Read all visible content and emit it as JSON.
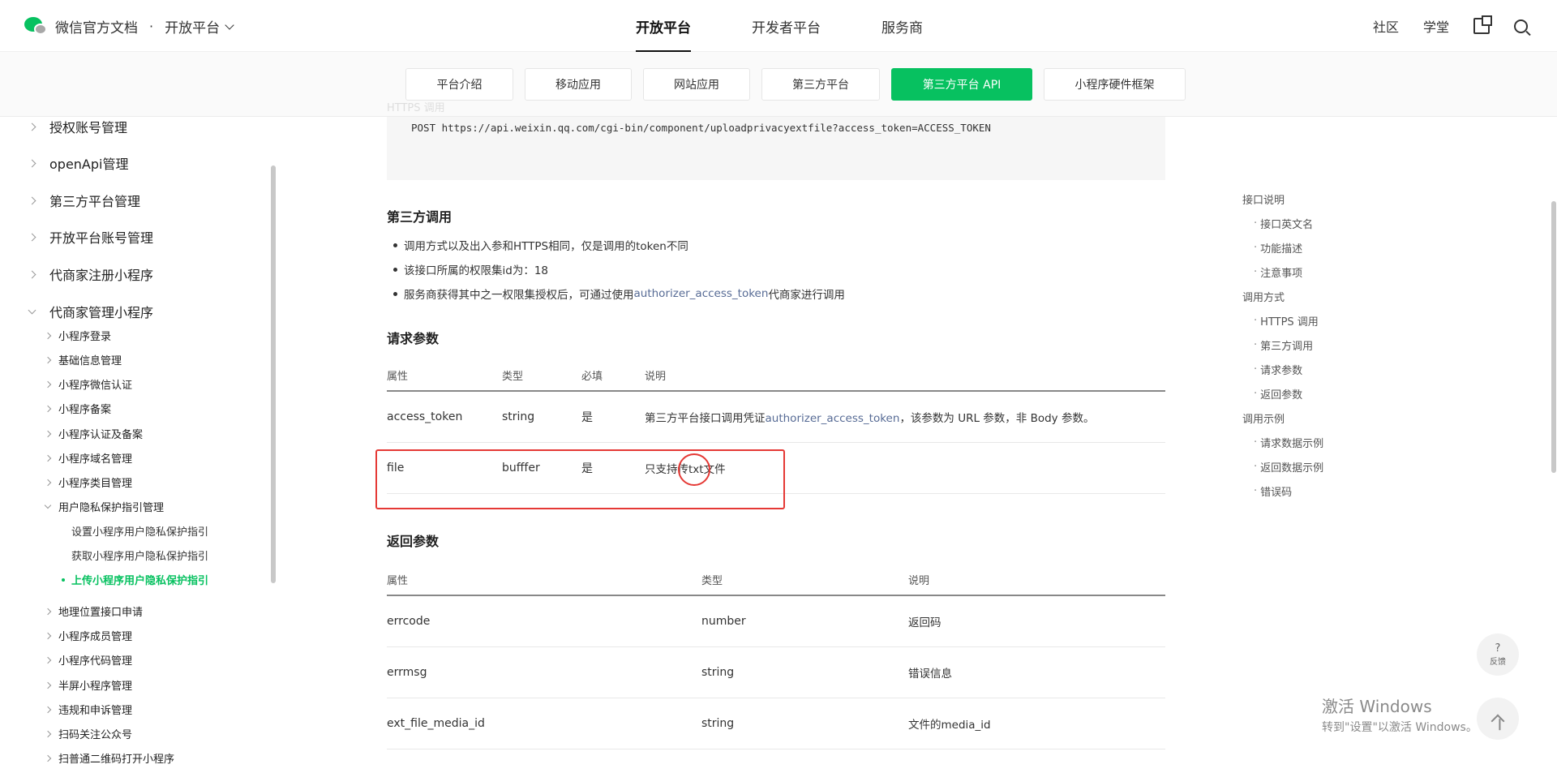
{
  "header": {
    "brand": "微信官方文档",
    "separator": "·",
    "platform_dropdown": "开放平台",
    "nav": [
      {
        "label": "开放平台",
        "active": true
      },
      {
        "label": "开发者平台",
        "active": false
      },
      {
        "label": "服务商",
        "active": false
      }
    ],
    "right": {
      "community": "社区",
      "academy": "学堂"
    }
  },
  "subnav": {
    "faint_heading": "HTTPS 调用",
    "tabs": [
      {
        "label": "平台介绍",
        "active": false
      },
      {
        "label": "移动应用",
        "active": false
      },
      {
        "label": "网站应用",
        "active": false
      },
      {
        "label": "第三方平台",
        "active": false
      },
      {
        "label": "第三方平台 API",
        "active": true
      },
      {
        "label": "小程序硬件框架",
        "active": false
      }
    ]
  },
  "sidebar": {
    "level1": [
      "授权账号管理",
      "openApi管理",
      "第三方平台管理",
      "开放平台账号管理",
      "代商家注册小程序",
      "代商家管理小程序"
    ],
    "level2_top": [
      "小程序登录",
      "基础信息管理",
      "小程序微信认证",
      "小程序备案",
      "小程序认证及备案",
      "小程序域名管理",
      "小程序类目管理",
      "用户隐私保护指引管理"
    ],
    "level3": [
      "设置小程序用户隐私保护指引",
      "获取小程序用户隐私保护指引",
      "上传小程序用户隐私保护指引"
    ],
    "level2_bottom": [
      "地理位置接口申请",
      "小程序成员管理",
      "小程序代码管理",
      "半屏小程序管理",
      "违规和申诉管理",
      "扫码关注公众号",
      "扫普通二维码打开小程序"
    ]
  },
  "content": {
    "code": "POST https://api.weixin.qq.com/cgi-bin/component/uploadprivacyextfile?access_token=ACCESS_TOKEN",
    "third_party_heading": "第三方调用",
    "bullets": {
      "b1": "调用方式以及出入参和HTTPS相同，仅是调用的token不同",
      "b2": "该接口所属的权限集id为：18",
      "b3_prefix": "服务商获得其中之一权限集授权后，可通过使用",
      "b3_link": "authorizer_access_token",
      "b3_suffix": "代商家进行调用"
    },
    "request_heading": "请求参数",
    "request_table": {
      "headers": [
        "属性",
        "类型",
        "必填",
        "说明"
      ],
      "rows": [
        {
          "name": "access_token",
          "type": "string",
          "required": "是",
          "desc_prefix": "第三方平台接口调用凭证",
          "desc_link": "authorizer_access_token",
          "desc_suffix": "，该参数为 URL 参数，非 Body 参数。"
        },
        {
          "name": "file",
          "type": "bufffer",
          "required": "是",
          "desc_prefix": "只支持传txt文件",
          "desc_link": "",
          "desc_suffix": ""
        }
      ]
    },
    "response_heading": "返回参数",
    "response_table": {
      "headers": [
        "属性",
        "类型",
        "说明"
      ],
      "rows": [
        {
          "name": "errcode",
          "type": "number",
          "desc": "返回码"
        },
        {
          "name": "errmsg",
          "type": "string",
          "desc": "错误信息"
        },
        {
          "name": "ext_file_media_id",
          "type": "string",
          "desc": "文件的media_id"
        }
      ]
    }
  },
  "toc": {
    "g1": "接口说明",
    "g1_items": [
      "接口英文名",
      "功能描述",
      "注意事项"
    ],
    "g2": "调用方式",
    "g2_items": [
      "HTTPS 调用",
      "第三方调用",
      "请求参数",
      "返回参数"
    ],
    "g3": "调用示例",
    "g3_items": [
      "请求数据示例",
      "返回数据示例",
      "错误码"
    ]
  },
  "floating": {
    "help_glyph": "?",
    "feedback": "反馈"
  },
  "watermark": {
    "line1": "激活 Windows",
    "line2": "转到\"设置\"以激活 Windows。"
  },
  "colors": {
    "accent": "#07c160",
    "link": "#576b95",
    "annotation": "#e53935"
  }
}
